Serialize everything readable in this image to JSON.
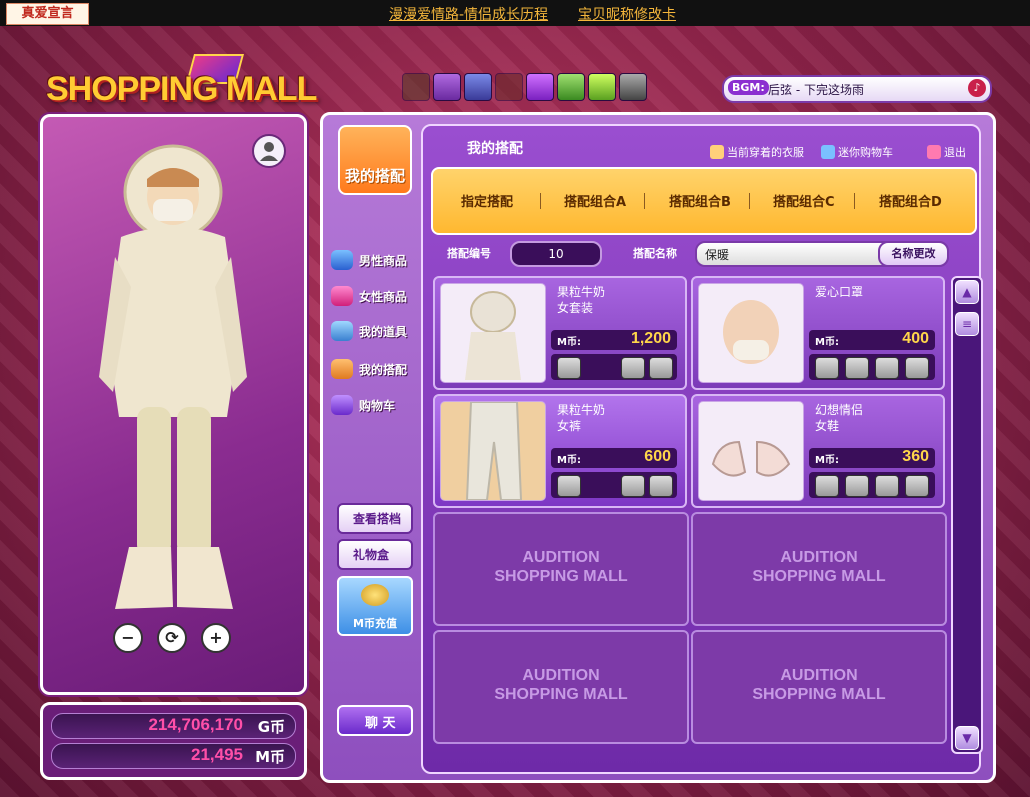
{
  "top": {
    "badge": "真爱宣言",
    "links": [
      "漫漫爱情路-情侣成长历程",
      "宝贝昵称修改卡"
    ]
  },
  "logo": {
    "text": "SHOPPING MALL"
  },
  "toolbar_icons": [
    "dancer-icon",
    "purple-dancer-icon",
    "face-icon",
    "dark-icon",
    "gift-icon",
    "photo-icon",
    "garden-icon",
    "gear-icon"
  ],
  "bgm": {
    "tag": "BGM:",
    "title": "后弦 - 下完这场雨"
  },
  "character": {
    "user_icon": "user-icon"
  },
  "currency": {
    "g": {
      "value": "214,706,170",
      "unit": "G币"
    },
    "m": {
      "value": "21,495",
      "unit": "M币"
    }
  },
  "sidebar": {
    "active_label": "我的搭配",
    "items": [
      {
        "label": "男性商品"
      },
      {
        "label": "女性商品"
      },
      {
        "label": "我的道具"
      },
      {
        "label": "我的搭配"
      },
      {
        "label": "购物车"
      }
    ],
    "view_btn": "查看搭档",
    "gift_btn": "礼物盒",
    "recharge_btn": "M币充值",
    "chat_btn": "聊 天"
  },
  "panel": {
    "title": "我的搭配",
    "header_links": [
      "当前穿着的衣服",
      "迷你购物车",
      "退出"
    ],
    "tabs": [
      "指定搭配",
      "搭配组合A",
      "搭配组合B",
      "搭配组合C",
      "搭配组合D"
    ],
    "num_label": "搭配编号",
    "num_value": "10",
    "name_label": "搭配名称",
    "name_value": "保暖",
    "rename_btn": "名称更改"
  },
  "items": [
    {
      "name_line1": "果粒牛奶",
      "name_line2": "女套装",
      "unit": "M币:",
      "price": "1,200"
    },
    {
      "name_line1": "爱心口罩",
      "name_line2": "",
      "unit": "M币:",
      "price": "400"
    },
    {
      "name_line1": "果粒牛奶",
      "name_line2": "女裤",
      "unit": "M币:",
      "price": "600"
    },
    {
      "name_line1": "幻想情侣",
      "name_line2": "女鞋",
      "unit": "M币:",
      "price": "360"
    }
  ],
  "empty_slot_text": "AUDITION\nSHOPPING MALL",
  "colors": {
    "accent": "#ffb830",
    "purple": "#8e4fbe",
    "price": "#ffd64a",
    "currency": "#ff4fa8"
  }
}
